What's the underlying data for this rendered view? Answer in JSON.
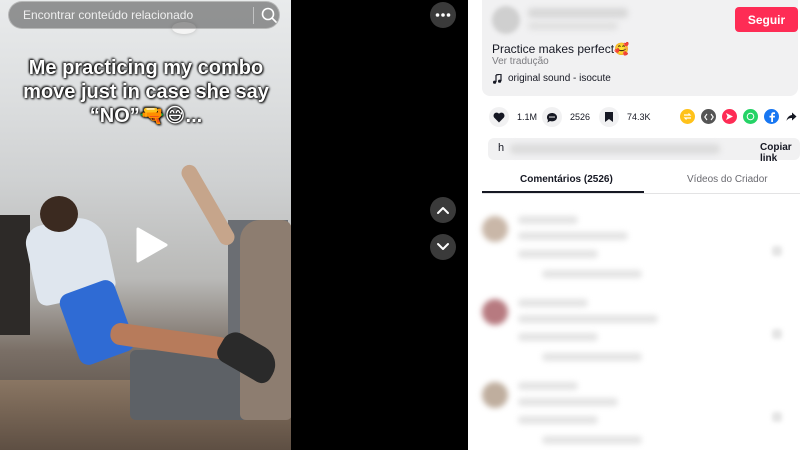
{
  "search": {
    "placeholder": "Encontrar conteúdo relacionado"
  },
  "video": {
    "caption": "Me practicing my combo move just in case she say “NO”🔫😅..."
  },
  "post": {
    "follow_label": "Seguir",
    "description": "Practice makes perfect🥰",
    "translate_label": "Ver tradução",
    "sound": "original sound - isocute"
  },
  "stats": {
    "likes": "1.1M",
    "comments": "2526",
    "saves": "74.3K"
  },
  "share_icons": [
    {
      "name": "repost-icon",
      "color": "#ffc21a"
    },
    {
      "name": "embed-icon",
      "color": "#555555"
    },
    {
      "name": "send-icon",
      "color": "#fe2c55"
    },
    {
      "name": "whatsapp-icon",
      "color": "#25d366"
    },
    {
      "name": "facebook-icon",
      "color": "#1877f2"
    },
    {
      "name": "share-arrow-icon",
      "color": "#161823"
    }
  ],
  "link_box": {
    "prefix": "h",
    "copy_label": "Copiar link"
  },
  "tabs": {
    "comments": "Comentários (2526)",
    "creator": "Vídeos do Criador"
  },
  "colors": {
    "accent": "#fe2c55",
    "text": "#161823",
    "muted": "#7c7c80"
  }
}
